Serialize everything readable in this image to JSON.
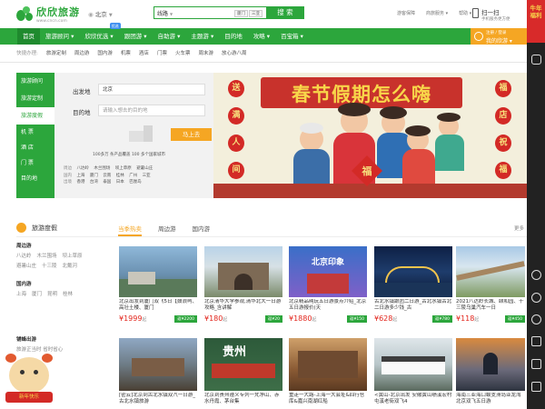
{
  "header": {
    "logo_text": "欣欣旅游",
    "logo_url": "www.cncn.com",
    "city": "北京",
    "search_type": "线路",
    "search_options": [
      "厦门",
      "三亚"
    ],
    "search_button": "搜 索",
    "links": [
      "游客保障",
      "商旅服务",
      "帮助"
    ],
    "scan_title": "扫一扫",
    "scan_sub": "手机服务更方便"
  },
  "nav": {
    "items": [
      "首页",
      "旅游顾问",
      "欣欣优选",
      "跟团游",
      "自助游",
      "主题游",
      "目的地",
      "攻略",
      "百宝箱"
    ],
    "badge": "优选",
    "member_title": "注册 / 登录",
    "member_label": "我的欣游"
  },
  "quick": {
    "label": "快捷办理:",
    "items": [
      "旅游定制",
      "周边游",
      "国内游",
      "机票",
      "酒店",
      "门票",
      "火车票",
      "周末游",
      "放心游八周"
    ]
  },
  "sidemenu": [
    "旅游顾问",
    "旅游定制",
    "旅游度假",
    "机 票",
    "酒 店",
    "门 票",
    "目的地"
  ],
  "booking": {
    "from_label": "出发地",
    "from_value": "北京",
    "to_label": "目的地",
    "to_placeholder": "请输入想去的目的地",
    "button": "马上去",
    "stats": "100多万 条产品覆盖 100 多个国家城市",
    "row_labels": [
      "周边",
      "国内",
      "出境"
    ],
    "row_zhoubian": [
      "八达岭",
      "木兰围场",
      "坝上草原",
      "避暑山庄"
    ],
    "row_guonei": [
      "上海",
      "厦门",
      "云南",
      "桂林",
      "广州",
      "三亚"
    ],
    "row_chujing": [
      "香港",
      "台湾",
      "泰国",
      "日本",
      "巴厘岛"
    ]
  },
  "banner": {
    "title": "春节假期怎么嗨",
    "left_lanterns": [
      "送",
      "满",
      "人",
      "间"
    ],
    "right_lanterns": [
      "福",
      "店",
      "祝",
      "福"
    ],
    "fu": "福"
  },
  "right_bar": {
    "promo_text": "牛年福利"
  },
  "section": {
    "title": "旅游度假",
    "tabs": [
      "当季热卖",
      "周边游",
      "国内游"
    ],
    "more": "更多",
    "left": {
      "h1": "周边游",
      "r1": [
        "八达岭",
        "木兰围场",
        "坝上草原"
      ],
      "r2": [
        "避暑山庄",
        "十三陵",
        "北戴河"
      ],
      "h2": "国内游",
      "r3": [
        "上海",
        "厦门",
        "昆明",
        "桂林"
      ],
      "h3": "铺蜂出游",
      "r4": [
        "旅游正当时 省时省心"
      ]
    },
    "mascot_label": "新年快乐",
    "cards": [
      {
        "title": "北京出发到厦门双飞5日【鼓浪屿、高壮土楼、厦门",
        "price": "¥1999",
        "unit": "起",
        "cashback": "返¥2200"
      },
      {
        "title": "北京清华大学参观,清华北大一日游攻略_含讲解",
        "price": "¥180",
        "unit": "起",
        "cashback": "返¥20"
      },
      {
        "title": "北京精品纯玩五日游景点介绍_北京五日游报价(天",
        "price": "¥1880",
        "unit": "起",
        "cashback": "返¥150"
      },
      {
        "title": "古北水镇跟团二日游_古北水镇古北二日游多少钱_古",
        "price": "¥628",
        "unit": "起",
        "cashback": "返¥780"
      },
      {
        "title": "2021八达岭长城、颐和园、十三陵乌巢汽车一日",
        "price": "¥118",
        "unit": "起",
        "cashback": "返¥450"
      },
      {
        "title": "[密云]北京到古北水镇双汽一日游_古北水镇旅游",
        "price": "",
        "unit": "",
        "cashback": ""
      },
      {
        "title": "北京到贵州遵义专列一梵净山、赤水丹霞、茅台集",
        "price": "",
        "unit": "",
        "cashback": ""
      },
      {
        "title": "重走一大路-上海一大会址&四行仓库&嘉兴南湖红船",
        "price": "",
        "unit": "",
        "cashback": ""
      },
      {
        "title": "<黄山-北京出发 安徽黄山绩溪宏村 屯溪老街双飞4",
        "price": "",
        "unit": "",
        "cashback": ""
      },
      {
        "title": "海南三亚海口蜈支洲岛亚龙湾北京双飞五日游",
        "price": "",
        "unit": "",
        "cashback": ""
      }
    ],
    "card_image_labels": [
      "",
      "",
      "北京印象",
      "",
      "",
      "",
      "贵州",
      "",
      "",
      ""
    ]
  },
  "colors": {
    "brand_green": "#2ca63c",
    "accent_orange": "#f5a623",
    "price_red": "#e2231a",
    "promo_red": "#d82a2a"
  }
}
